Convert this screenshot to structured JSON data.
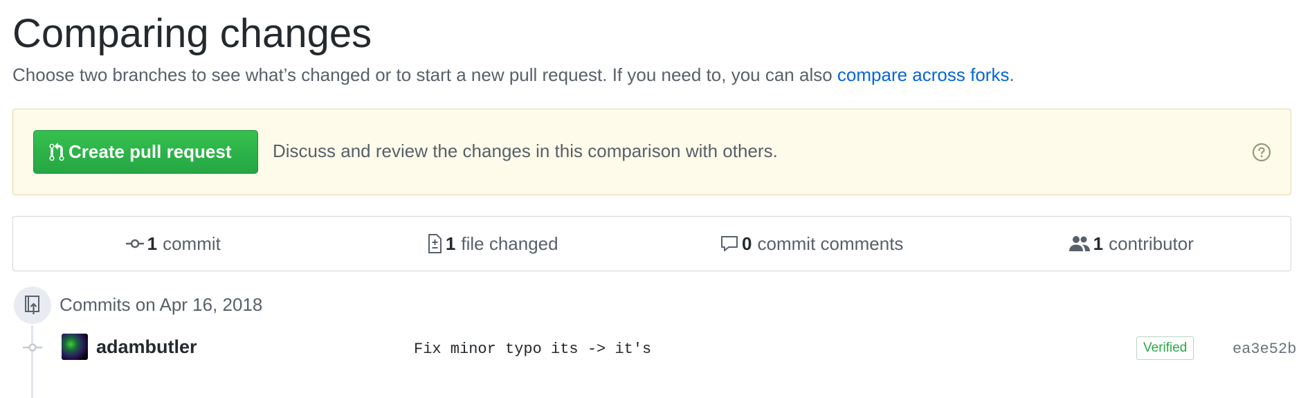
{
  "header": {
    "title": "Comparing changes",
    "lead_text": "Choose two branches to see what’s changed or to start a new pull request. If you need to, you can also ",
    "compare_forks_link": "compare across forks",
    "lead_period": "."
  },
  "flash": {
    "button_label": "Create pull request",
    "message": "Discuss and review the changes in this comparison with others.",
    "help_icon": "question-circle-icon"
  },
  "summary": {
    "commits": {
      "count": "1",
      "label": "commit",
      "icon": "git-commit-icon"
    },
    "files": {
      "count": "1",
      "label": "file changed",
      "icon": "file-diff-icon"
    },
    "comments": {
      "count": "0",
      "label": "commit comments",
      "icon": "comment-icon"
    },
    "contributors": {
      "count": "1",
      "label": "contributor",
      "icon": "people-icon"
    }
  },
  "commits": {
    "date_heading": "Commits on Apr 16, 2018",
    "items": [
      {
        "author": "adambutler",
        "message": "Fix minor typo its -> it's",
        "verified_label": "Verified",
        "sha": "ea3e52b"
      }
    ]
  },
  "colors": {
    "link": "#0366d6",
    "create_button": "#28a745",
    "flash_background": "#fffbea",
    "verified": "#28a745"
  }
}
